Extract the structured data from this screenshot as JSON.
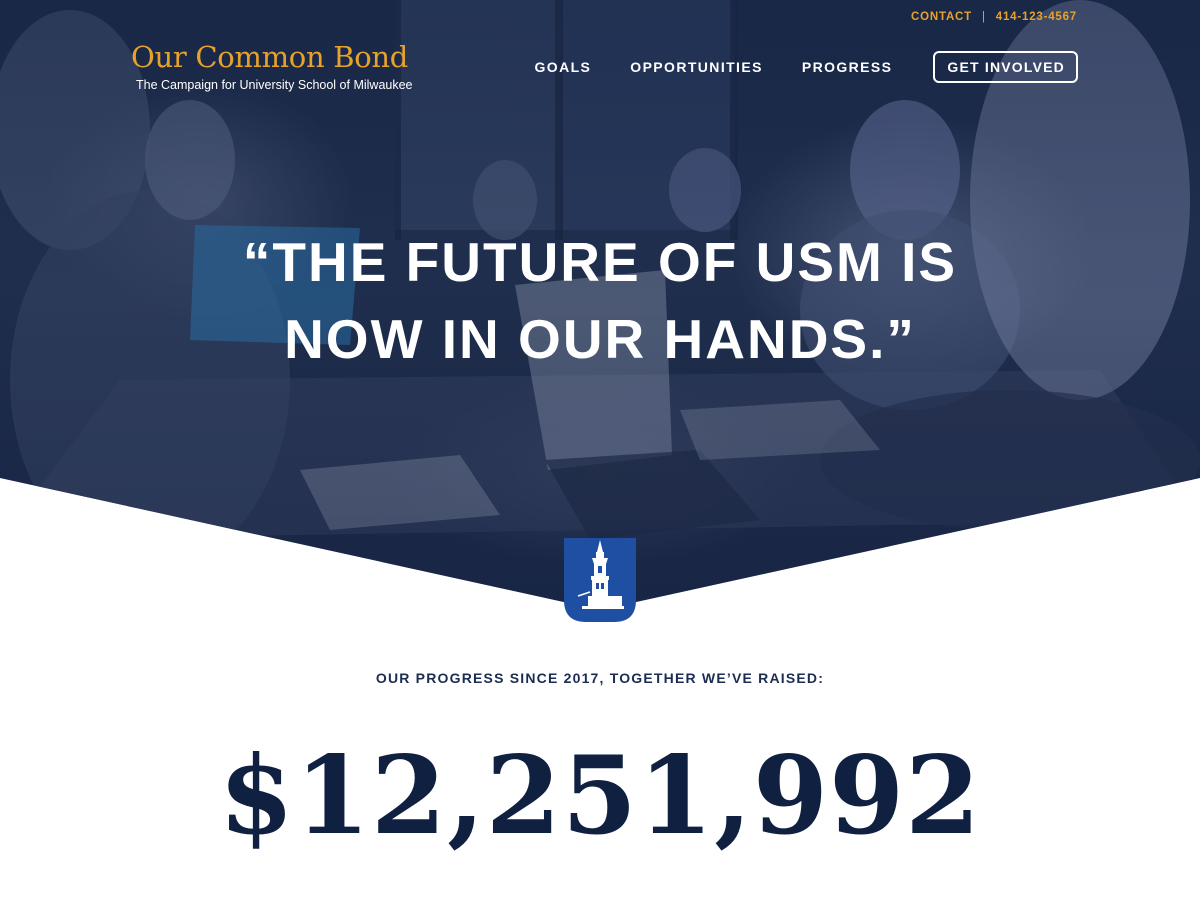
{
  "brand": {
    "title": "Our Common Bond",
    "subtitle": "The Campaign for University School of Milwaukee"
  },
  "utility": {
    "contact_label": "CONTACT",
    "divider": "|",
    "phone": "414-123-4567"
  },
  "nav": {
    "items": [
      {
        "label": "GOALS"
      },
      {
        "label": "OPPORTUNITIES"
      },
      {
        "label": "PROGRESS"
      }
    ],
    "cta_label": "GET INVOLVED"
  },
  "hero": {
    "headline_line1": "“THE FUTURE OF USM IS",
    "headline_line2": "NOW IN OUR HANDS.”"
  },
  "progress": {
    "label": "OUR PROGRESS SINCE 2017, TOGETHER WE’VE RAISED:",
    "amount": "$12,251,992"
  },
  "icons": {
    "crest": "usm-tower-crest-icon"
  },
  "colors": {
    "brand_gold": "#e8a22a",
    "navy": "#1b2d52",
    "crest_blue": "#1f4fa3"
  }
}
